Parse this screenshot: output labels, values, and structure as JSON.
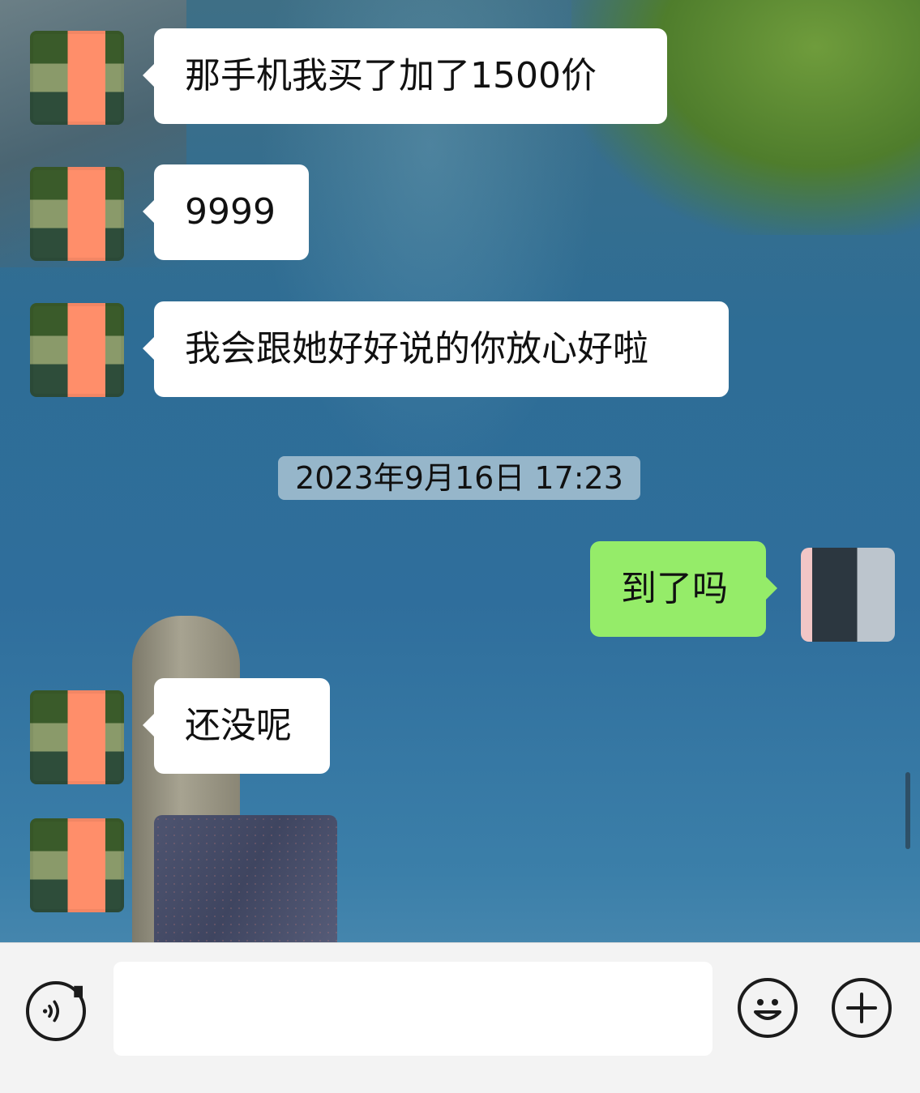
{
  "chat": {
    "messages": [
      {
        "side": "left",
        "text": "那手机我买了加了1500价"
      },
      {
        "side": "left",
        "text": "9999"
      },
      {
        "side": "left",
        "text": "我会跟她好好说的你放心好啦"
      },
      {
        "side": "right",
        "text": "到了吗"
      },
      {
        "side": "left",
        "text": "还没呢"
      }
    ],
    "timestamp": "2023年9月16日 17:23",
    "image_message": "photo-thumbnail"
  },
  "input_bar": {
    "text_value": "",
    "icons": {
      "voice": "voice-icon",
      "emoji": "emoji-icon",
      "plus": "plus-icon"
    }
  },
  "colors": {
    "outgoing_bubble": "#95ec69",
    "incoming_bubble": "#ffffff",
    "input_bar_bg": "#f3f3f3"
  }
}
